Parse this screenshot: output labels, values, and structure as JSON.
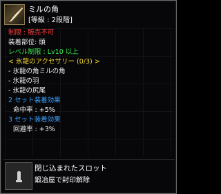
{
  "item": {
    "name": "ミルの角",
    "grade": "[等級 : 2段階]",
    "restriction": "制限 : 販売不可",
    "equip_slot": "装着部位: 頭",
    "level_req": "レベル制限 : Lv10 以上",
    "set_name": "< 氷龍のアクセサリー (0/3) >",
    "set_items": [
      "- 氷龍の角ミルの角",
      "- 氷龍の羽",
      "- 氷龍の尻尾"
    ],
    "set_bonus_2_label": "2 セット装着効果",
    "set_bonus_2_value": "命中率 : +5%",
    "set_bonus_3_label": "3 セット装着効果",
    "set_bonus_3_value": "回避率 : +3%"
  },
  "slot": {
    "title": "閉じ込まれたスロット",
    "subtitle": "鍛冶屋で封印解除"
  },
  "colors": {
    "restriction": "#ff3a3a",
    "level_req": "#38e84c",
    "set_name": "#f0d42a",
    "set_bonus_label": "#3aa2ff"
  },
  "icons": {
    "item": "horn-icon",
    "slot": "locked-slot-icon"
  }
}
